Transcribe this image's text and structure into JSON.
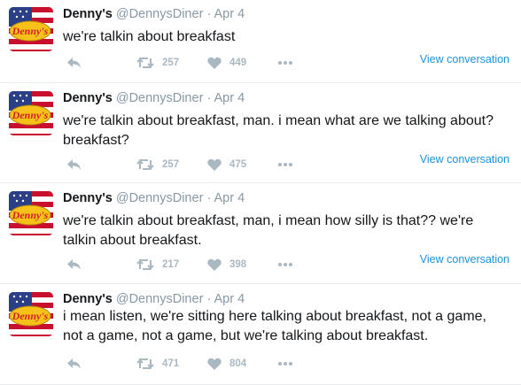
{
  "tweets": [
    {
      "display_name": "Denny's",
      "handle": "@DennysDiner",
      "separator": "·",
      "date": "Apr 4",
      "lines": [
        "we're talkin about breakfast"
      ],
      "retweets": "257",
      "likes": "449",
      "view_conversation": "View conversation"
    },
    {
      "display_name": "Denny's",
      "handle": "@DennysDiner",
      "separator": "·",
      "date": "Apr 4",
      "lines": [
        "we're talkin about breakfast, man. i mean what are we talking about?",
        "breakfast?"
      ],
      "retweets": "257",
      "likes": "475",
      "view_conversation": "View conversation"
    },
    {
      "display_name": "Denny's",
      "handle": "@DennysDiner",
      "separator": "·",
      "date": "Apr 4",
      "lines": [
        "we're talkin about breakfast, man, i mean how silly is that?? we're",
        "talkin about breakfast."
      ],
      "retweets": "217",
      "likes": "398",
      "view_conversation": "View conversation"
    },
    {
      "display_name": "Denny's",
      "handle": "@DennysDiner",
      "separator": "·",
      "date": "Apr 4",
      "lines": [
        "i mean listen, we're sitting here talking about breakfast, not a game,",
        "not a game, not a game, but we're talking about breakfast."
      ],
      "retweets": "471",
      "likes": "804"
    }
  ],
  "avatar_logo_text": "Denny's",
  "colors": {
    "link": "#1b95e0",
    "action_icon": "#aab8c2",
    "meta_text": "#8899a6",
    "divider": "#e6ecf0",
    "logo_yellow": "#f6c21a",
    "logo_red": "#d32027"
  },
  "icons": [
    "reply-icon",
    "retweet-icon",
    "heart-icon",
    "more-icon",
    "american-flag-denny-logo"
  ]
}
